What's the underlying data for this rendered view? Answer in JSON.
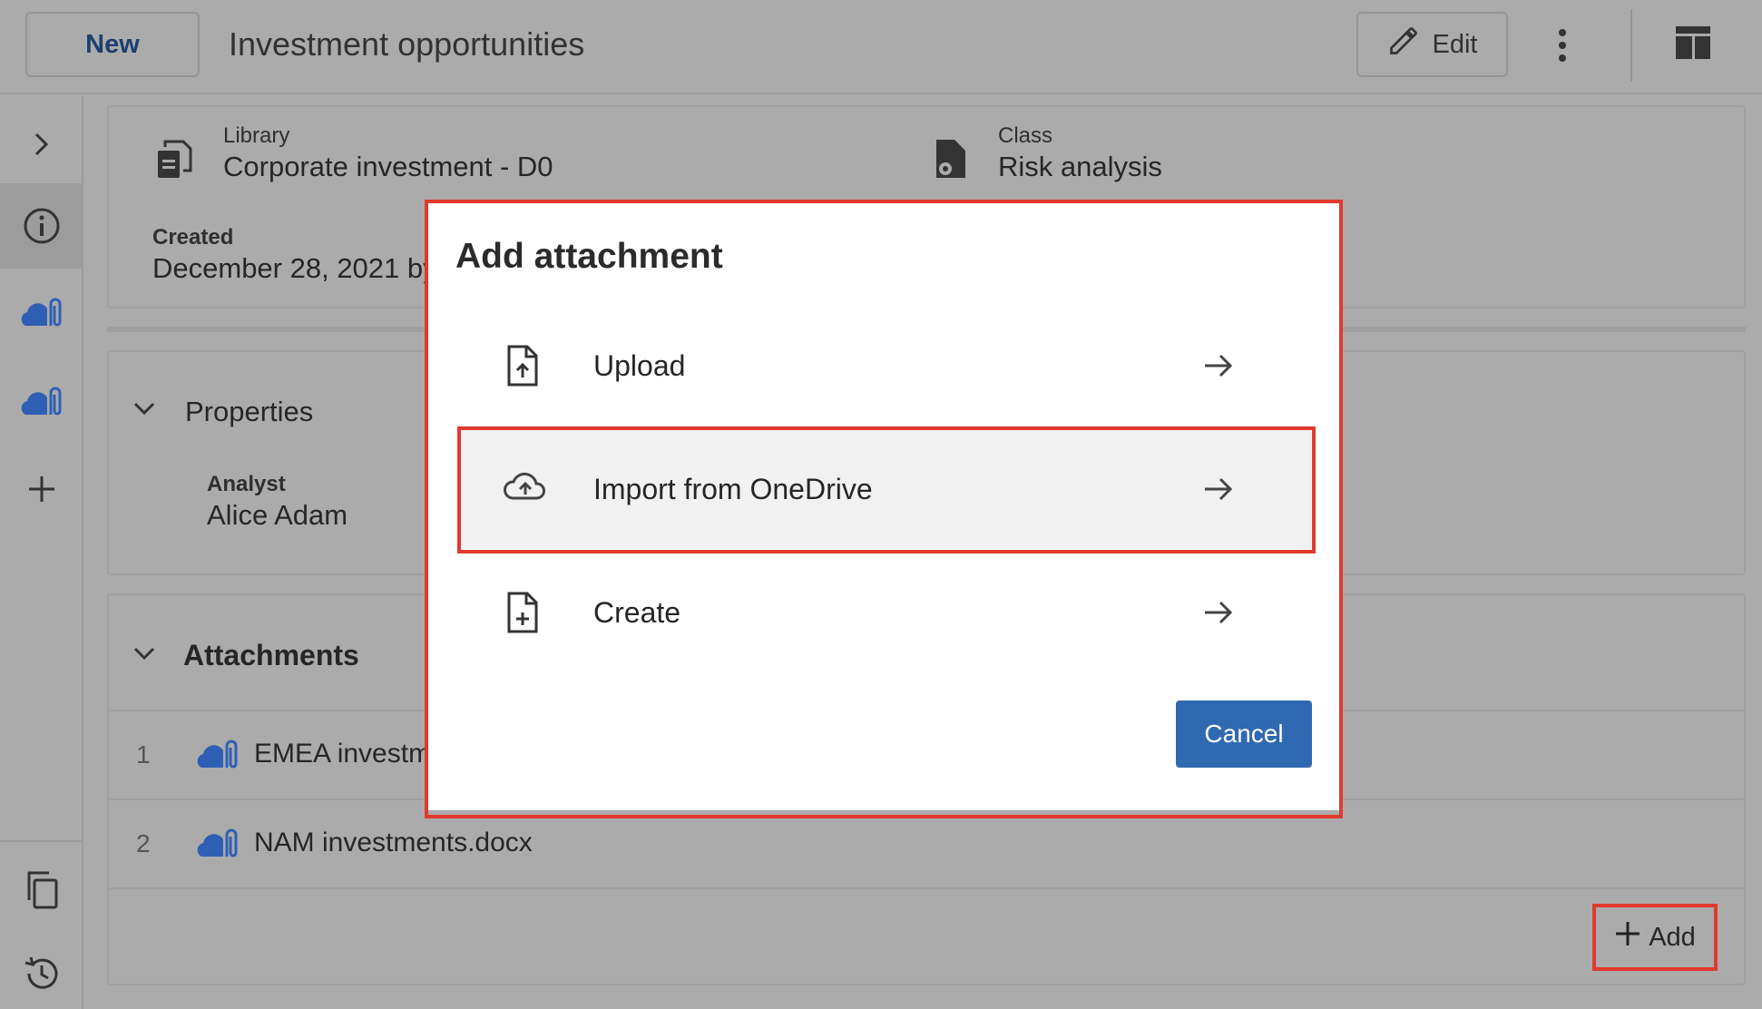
{
  "header": {
    "new_label": "New",
    "title": "Investment opportunities",
    "edit_label": "Edit"
  },
  "summary": {
    "library_label": "Library",
    "library_value": "Corporate investment - D0",
    "class_label": "Class",
    "class_value": "Risk analysis",
    "created_label": "Created",
    "created_value": "December 28, 2021 by"
  },
  "properties": {
    "section_title": "Properties",
    "analyst_label": "Analyst",
    "analyst_value": "Alice Adam"
  },
  "attachments": {
    "section_title": "Attachments",
    "rows": [
      {
        "index": "1",
        "name": "EMEA investm"
      },
      {
        "index": "2",
        "name": "NAM investments.docx"
      }
    ],
    "add_label": "Add"
  },
  "dialog": {
    "title": "Add attachment",
    "options": [
      {
        "label": "Upload"
      },
      {
        "label": "Import from OneDrive"
      },
      {
        "label": "Create"
      }
    ],
    "cancel_label": "Cancel"
  },
  "colors": {
    "accent": "#2f69b1",
    "highlight": "#e03a2f",
    "cloud_icon": "#2f5fb5"
  }
}
